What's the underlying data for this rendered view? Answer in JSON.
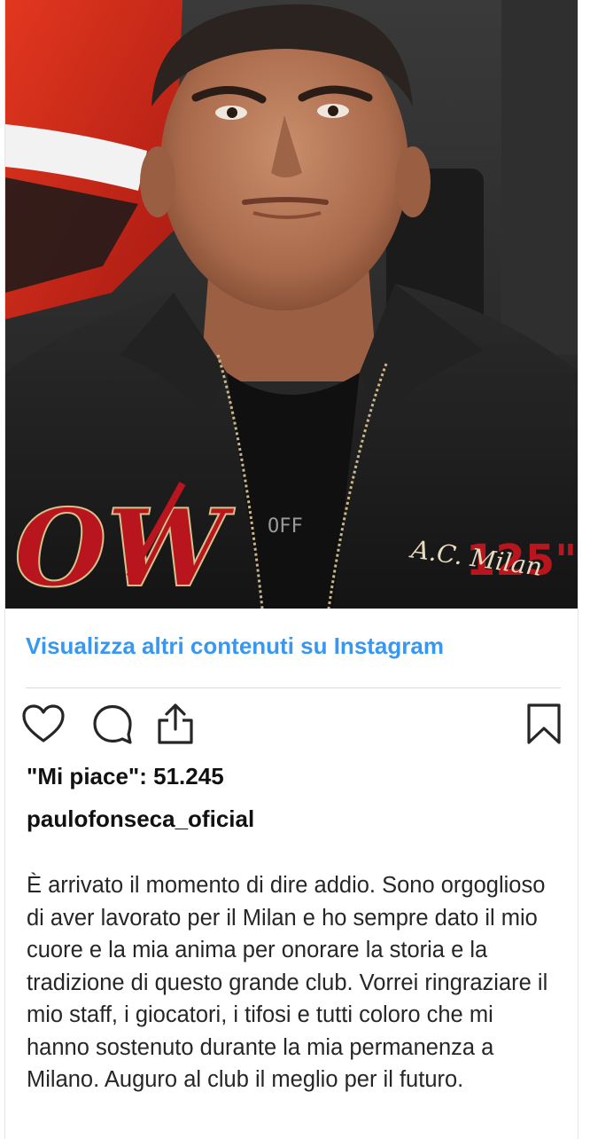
{
  "post": {
    "image_alt": "Paulo Fonseca in AC Milan jacket",
    "jacket_text_left": "OFF",
    "jacket_badge": "125\"",
    "jacket_club": "A.C. Milan",
    "view_more_label": "Visualizza altri contenuti su Instagram",
    "likes_text": "\"Mi piace\": 51.245",
    "username": "paulofonseca_oficial",
    "caption": "È arrivato il momento di dire addio. Sono orgoglioso di aver lavorato per il Milan e ho sempre dato il mio cuore e la mia anima per onorare la storia e la tradizione di questo grande club. Vorrei ringraziare il mio staff, i giocatori, i tifosi e tutti coloro che mi hanno sostenuto durante la mia permanenza a Milano. Auguro al club il meglio per il futuro."
  },
  "actions": {
    "like_icon": "heart-icon",
    "comment_icon": "comment-bubble-icon",
    "share_icon": "share-upload-icon",
    "save_icon": "bookmark-icon"
  },
  "colors": {
    "link": "#3897f0",
    "text": "#262626",
    "milan_red": "#c8102e"
  }
}
